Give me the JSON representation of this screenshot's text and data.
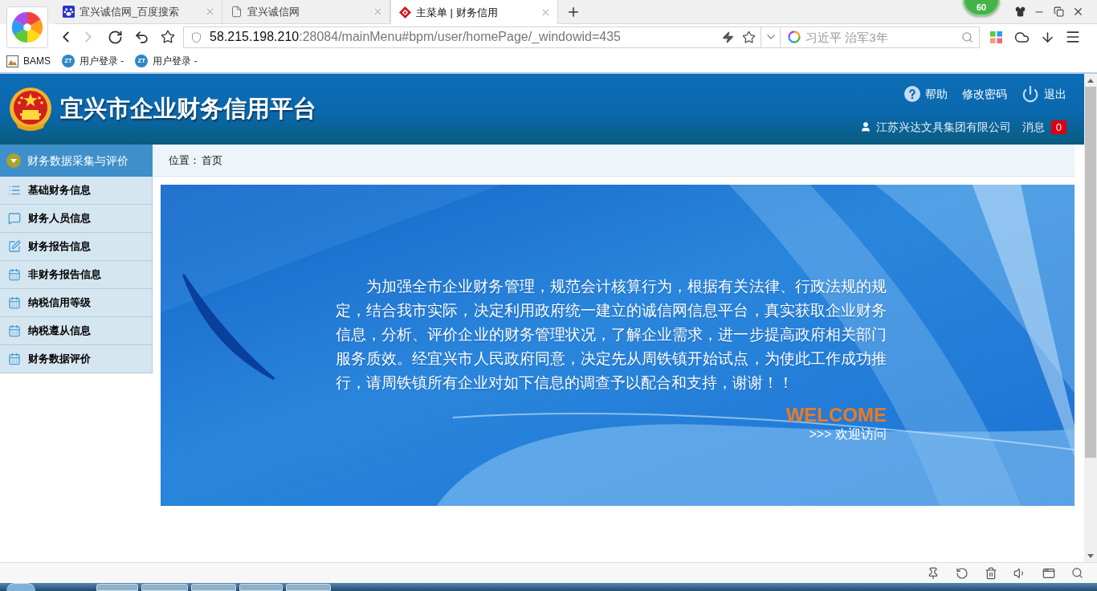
{
  "browser": {
    "tabs": [
      {
        "title": "宜兴诚信网_百度搜索",
        "selected": false,
        "kind": "paw"
      },
      {
        "title": "宜兴诚信网",
        "selected": false,
        "kind": "page"
      },
      {
        "title": "主菜单 | 财务信用",
        "selected": true,
        "kind": "logo"
      }
    ],
    "badge": "60",
    "address": {
      "host": "58.215.198.210",
      "path": ":28084/mainMenu#bpm/user/homePage/_windowid=435"
    },
    "search": {
      "placeholder": "习近平 治军3年"
    },
    "bookmarks": [
      {
        "label": "BAMS",
        "kind": "image"
      },
      {
        "label": "用户登录 -",
        "kind": "site",
        "logo": "ZT"
      },
      {
        "label": "用户登录 -",
        "kind": "site",
        "logo": "ZT"
      }
    ]
  },
  "header": {
    "title": "宜兴市企业财务信用平台",
    "links": [
      {
        "label": "帮助",
        "kind": "help"
      },
      {
        "label": "修改密码",
        "kind": "plain"
      },
      {
        "label": "退出",
        "kind": "power"
      }
    ],
    "user": "江苏兴达文具集团有限公司",
    "messages": {
      "label": "消息",
      "count": "0"
    }
  },
  "sidebar": {
    "section": {
      "label": "财务数据采集与评价",
      "expanded": true
    },
    "items": [
      {
        "label": "基础财务信息",
        "kind": "list"
      },
      {
        "label": "财务人员信息",
        "kind": "message"
      },
      {
        "label": "财务报告信息",
        "kind": "edit"
      },
      {
        "label": "非财务报告信息",
        "kind": "calendar"
      },
      {
        "label": "纳税信用等级",
        "kind": "calendar"
      },
      {
        "label": "纳税遵从信息",
        "kind": "calendar"
      },
      {
        "label": "财务数据评价",
        "kind": "calendar"
      }
    ]
  },
  "breadcrumb": {
    "label": "位置：",
    "current": "首页"
  },
  "banner": {
    "paragraph": "为加强全市企业财务管理，规范会计核算行为，根据有关法律、行政法规的规定，结合我市实际，决定利用政府统一建立的诚信网信息平台，真实获取企业财务信息，分析、评价企业的财务管理状况，了解企业需求，进一步提高政府相关部门服务质效。经宜兴市人民政府同意，决定先从周铁镇开始试点，为使此工作成功推行，请周铁镇所有企业对如下信息的调查予以配合和支持，谢谢！！",
    "welcome": "WELCOME",
    "subtitle": ">>> 欢迎访问"
  }
}
